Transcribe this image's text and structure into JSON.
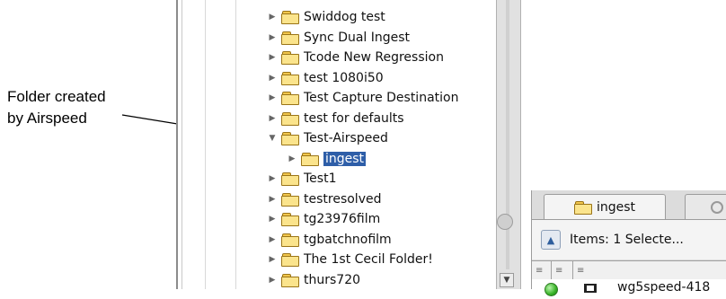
{
  "callout": {
    "line1": "Folder created",
    "line2": "by Airspeed"
  },
  "tree": {
    "items": [
      {
        "label": "Swiddog test",
        "expanded": false,
        "depth": 0
      },
      {
        "label": "Sync Dual Ingest",
        "expanded": false,
        "depth": 0
      },
      {
        "label": "Tcode New Regression",
        "expanded": false,
        "depth": 0
      },
      {
        "label": "test 1080i50",
        "expanded": false,
        "depth": 0
      },
      {
        "label": "Test Capture Destination",
        "expanded": false,
        "depth": 0
      },
      {
        "label": "test for defaults",
        "expanded": false,
        "depth": 0
      },
      {
        "label": "Test-Airspeed",
        "expanded": true,
        "depth": 0
      },
      {
        "label": "ingest",
        "expanded": false,
        "depth": 1,
        "selected": true
      },
      {
        "label": "Test1",
        "expanded": false,
        "depth": 0
      },
      {
        "label": "testresolved",
        "expanded": false,
        "depth": 0
      },
      {
        "label": "tg23976film",
        "expanded": false,
        "depth": 0
      },
      {
        "label": "tgbatchnofilm",
        "expanded": false,
        "depth": 0
      },
      {
        "label": "The 1st Cecil Folder!",
        "expanded": false,
        "depth": 0
      },
      {
        "label": "thurs720",
        "expanded": false,
        "depth": 0
      }
    ]
  },
  "bin": {
    "tab_label": "ingest",
    "items_text": "Items: 1 Selecte...",
    "columns": [
      "≡",
      "≡",
      "≡"
    ],
    "rows": [
      {
        "status": "online",
        "icon": "clip-icon",
        "name": "wg5speed-418"
      }
    ]
  },
  "colors": {
    "selection": "#2e5ea8",
    "folder": "#fbe48c",
    "status_online": "#37b226"
  }
}
